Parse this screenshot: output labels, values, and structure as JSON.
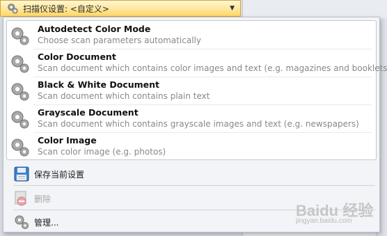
{
  "header": {
    "label": "扫描仪设置: <自定义>",
    "icon": "scanner-settings-icon",
    "arrow": "▼"
  },
  "modes": [
    {
      "title": "Autodetect Color Mode",
      "desc": "Choose scan parameters automatically",
      "icon": "gear-icon"
    },
    {
      "title": "Color Document",
      "desc": "Scan document which contains color images and text (e.g. magazines and booklets)",
      "icon": "gear-icon"
    },
    {
      "title": "Black & White Document",
      "desc": "Scan document which contains plain text",
      "icon": "gear-icon"
    },
    {
      "title": "Grayscale Document",
      "desc": "Scan document which contains grayscale images and text (e.g. newspapers)",
      "icon": "gear-icon"
    },
    {
      "title": "Color Image",
      "desc": "Scan color image (e.g. photos)",
      "icon": "gear-icon"
    }
  ],
  "actions": {
    "save": {
      "label": "保存当前设置",
      "icon": "floppy-disk-icon"
    },
    "delete": {
      "label": "删除",
      "icon": "delete-icon",
      "disabled": true
    },
    "manage": {
      "label": "管理...",
      "icon": "gear-icon"
    }
  },
  "watermark": {
    "logo": "Baidu 经验",
    "url": "jingyan.baidu.com"
  },
  "colors": {
    "header_top": "#fff7d6",
    "header_bottom": "#ffd86a",
    "accent_border": "#d3a53b"
  }
}
